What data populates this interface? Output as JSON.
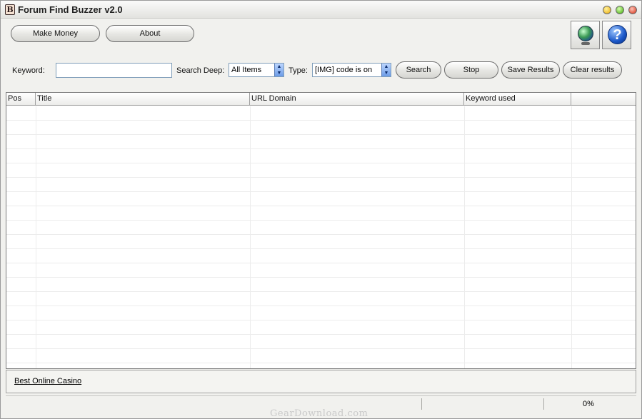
{
  "window": {
    "title": "Forum Find Buzzer v2.0",
    "app_icon_glyph": "B"
  },
  "toolbar": {
    "make_money_label": "Make Money",
    "about_label": "About",
    "globe_icon": "globe-icon",
    "help_icon": "help-icon",
    "help_glyph": "?"
  },
  "search": {
    "keyword_label": "Keyword:",
    "keyword_value": "",
    "search_deep_label": "Search Deep:",
    "search_deep_value": "All Items",
    "type_label": "Type:",
    "type_value": "[IMG] code is on",
    "search_label": "Search",
    "stop_label": "Stop",
    "save_results_label": "Save Results",
    "clear_results_label": "Clear results"
  },
  "results": {
    "columns": [
      "Pos",
      "Title",
      "URL Domain",
      "Keyword used",
      ""
    ],
    "rows": []
  },
  "footer": {
    "link_text": "Best Online Casino"
  },
  "status": {
    "progress_text": "0%",
    "progress": 0
  },
  "watermark": "GearDownload.com"
}
